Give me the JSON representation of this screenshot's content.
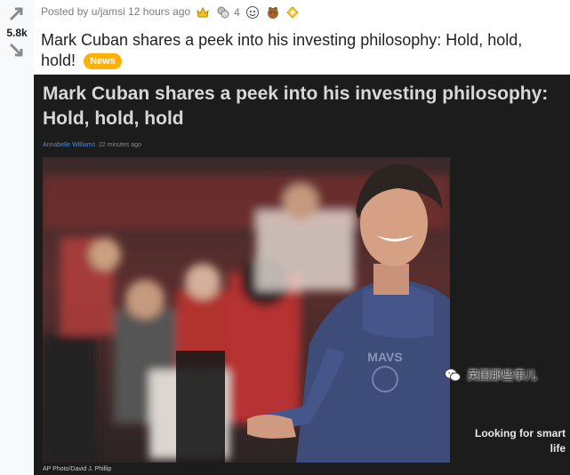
{
  "vote": {
    "score": "5.8k"
  },
  "post": {
    "meta": "Posted by u/jamsi 12 hours ago",
    "award_count": "4",
    "awards": [
      "gold-award-icon",
      "silver-award-icon",
      "wholesome-award-icon",
      "hug-award-icon",
      "helpful-award-icon"
    ],
    "title": "Mark Cuban shares a peek into his investing philosophy: Hold, hold, hold!",
    "flair": "News",
    "flair_color": "#ffb000"
  },
  "article": {
    "headline_line1": "Mark Cuban shares a peek into his investing philosophy:",
    "headline_line2": "Hold, hold, hold",
    "author": "Annabelle Williams",
    "time": "22 minutes ago",
    "credit": "AP Photo/David J. Phillip",
    "side_line1": "Looking for smart",
    "side_line2": "life"
  },
  "watermark": {
    "text": "英国那些事儿"
  }
}
